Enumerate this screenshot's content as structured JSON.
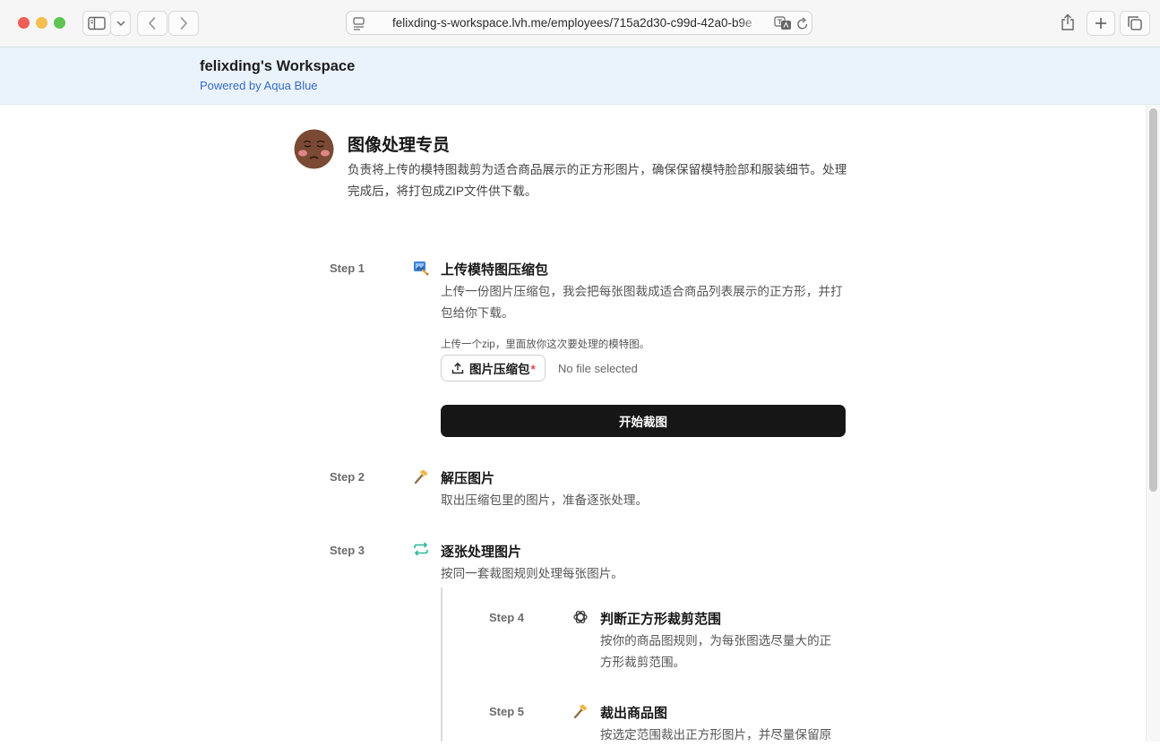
{
  "browser": {
    "url": "felixding-s-workspace.lvh.me/employees/715a2d30-c99d-42a0-b9e"
  },
  "workspace": {
    "title": "felixding's Workspace",
    "subtitle": "Powered by Aqua Blue"
  },
  "employee": {
    "title": "图像处理专员",
    "description": "负责将上传的模特图裁剪为适合商品展示的正方形图片，确保保留模特脸部和服装细节。处理完成后，将打包成ZIP文件供下载。"
  },
  "steps": [
    {
      "label": "Step 1",
      "icon": "upload-image-icon",
      "title": "上传模特图压缩包",
      "description": "上传一份图片压缩包，我会把每张图裁成适合商品列表展示的正方形，并打包给你下载。",
      "upload_hint": "上传一个zip，里面放你这次要处理的模特图。",
      "upload_label": "图片压缩包",
      "required_mark": "*",
      "file_status": "No file selected",
      "action_label": "开始裁图"
    },
    {
      "label": "Step 2",
      "icon": "hammer-icon",
      "title": "解压图片",
      "description": "取出压缩包里的图片，准备逐张处理。"
    },
    {
      "label": "Step 3",
      "icon": "loop-icon",
      "title": "逐张处理图片",
      "description": "按同一套裁图规则处理每张图片。"
    },
    {
      "label": "Step 4",
      "icon": "openai-icon",
      "title": "判断正方形裁剪范围",
      "description": "按你的商品图规则，为每张图选尽量大的正方形裁剪范围。"
    },
    {
      "label": "Step 5",
      "icon": "hammer-icon",
      "title": "裁出商品图",
      "description": "按选定范围裁出正方形图片，并尽量保留原"
    }
  ],
  "colors": {
    "accent_link": "#3569c4",
    "header_bg": "#eaf3fb",
    "primary_button": "#161616",
    "required": "#e5484d",
    "loop_icon": "#2bb89a"
  }
}
